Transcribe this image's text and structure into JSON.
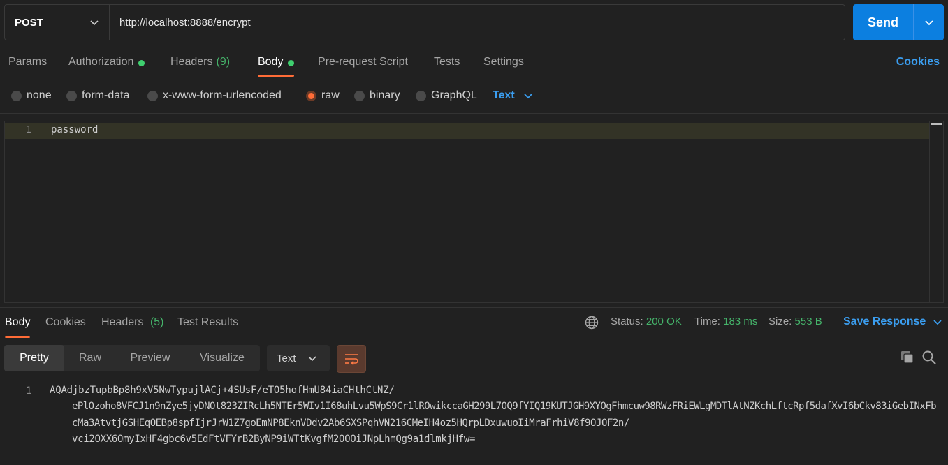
{
  "request": {
    "method": "POST",
    "url": "http://localhost:8888/encrypt",
    "send_label": "Send"
  },
  "req_tabs": {
    "params": "Params",
    "authorization": "Authorization",
    "headers": "Headers",
    "headers_count": "(9)",
    "body": "Body",
    "prerequest": "Pre-request Script",
    "tests": "Tests",
    "settings": "Settings",
    "cookies": "Cookies"
  },
  "body_types": {
    "none": "none",
    "form_data": "form-data",
    "urlencoded": "x-www-form-urlencoded",
    "raw": "raw",
    "binary": "binary",
    "graphql": "GraphQL",
    "selected": "raw",
    "text_type": "Text"
  },
  "editor": {
    "line_number": "1",
    "content": "password"
  },
  "response": {
    "tabs": {
      "body": "Body",
      "cookies": "Cookies",
      "headers": "Headers",
      "headers_count": "(5)",
      "test_results": "Test Results"
    },
    "status_label": "Status:",
    "status_value": "200 OK",
    "time_label": "Time:",
    "time_value": "183 ms",
    "size_label": "Size:",
    "size_value": "553 B",
    "save_label": "Save Response",
    "views": {
      "pretty": "Pretty",
      "raw": "Raw",
      "preview": "Preview",
      "visualize": "Visualize",
      "selected": "Pretty"
    },
    "format": "Text",
    "line_number": "1",
    "lines": [
      "AQAdjbzTupbBp8h9xV5NwTypujlACj+4SUsF/eTO5hofHmU84iaCHthCtNZ/",
      "ePlOzoho8VFCJ1n9nZye5jyDNOt823ZIRcLh5NTEr5WIv1I68uhLvu5WpS9Cr1lROwikccaGH299L7OQ9fYIQ19KUTJGH9XYOgFhmcuw98RWzFRiEWLgMDTlAtNZKchLftcRpf5dafXvI6bCkv83iGebINxFb",
      "cMa3AtvtjGSHEqOEBp8spfIjrJrW1Z7goEmNP8EknVDdv2Ab6SXSPqhVN216CMeIH4oz5HQrpLDxuwuoIiMraFrhiV8f9OJOF2n/",
      "vci2OXX6OmyIxHF4gbc6v5EdFtVFYrB2ByNP9iWTtKvgfM2OOOiJNpLhmQg9a1dlmkjHfw="
    ]
  },
  "colors": {
    "accent_orange": "#ff6c37",
    "send_blue": "#0c7fe0",
    "link_blue": "#3b9ef0",
    "status_green": "#45b36a"
  }
}
